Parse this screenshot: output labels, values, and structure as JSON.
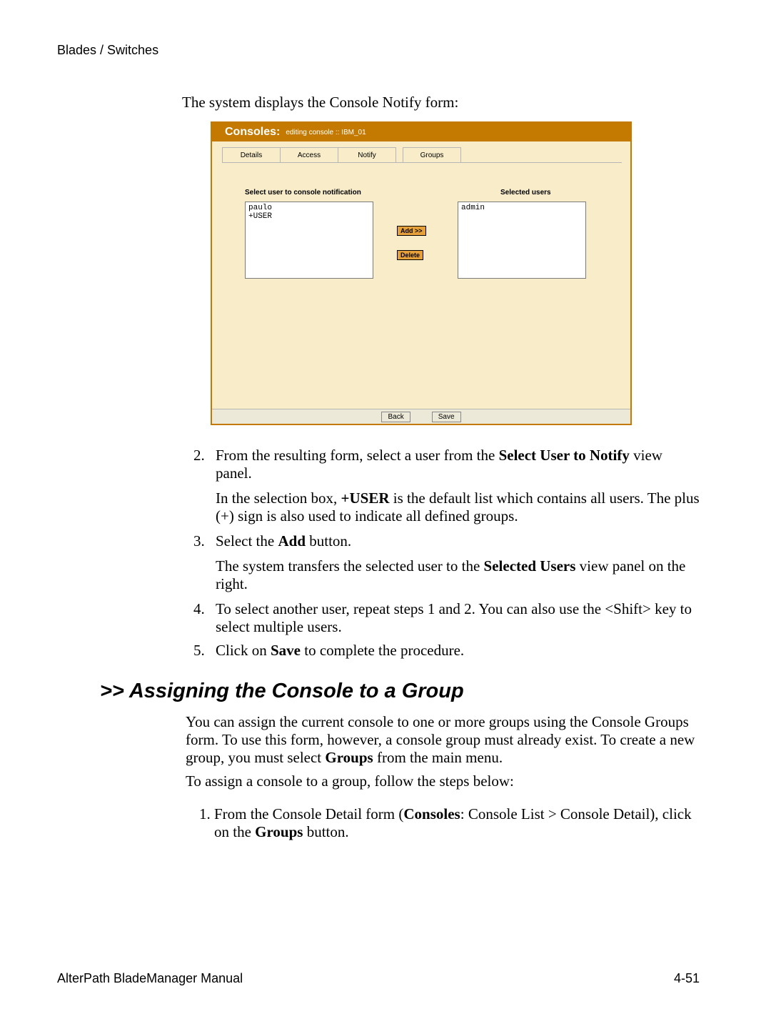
{
  "header": "Blades / Switches",
  "intro": "The system displays the Console Notify form:",
  "screenshot": {
    "title": "Consoles:",
    "subtitle": "editing console  ::  IBM_01",
    "tabs": [
      "Details",
      "Access",
      "Notify",
      "Groups"
    ],
    "left_label": "Select user to console notification",
    "right_label": "Selected users",
    "left_list": [
      "paulo",
      "+USER"
    ],
    "right_list": [
      "admin"
    ],
    "add_btn": "Add >>",
    "delete_btn": "Delete",
    "back_btn": "Back",
    "save_btn": "Save"
  },
  "steps1": {
    "s2a": "From the resulting form, select a user from the ",
    "s2b": "Select User to Notify",
    "s2c": " view panel.",
    "s2_detail_a": "In the selection box, ",
    "s2_detail_b": "+USER",
    "s2_detail_c": " is the default list which contains all users. The plus (+) sign is also used to indicate all defined groups.",
    "s3a": "Select the ",
    "s3b": "Add",
    "s3c": " button.",
    "s3_detail_a": "The system transfers the selected user to the ",
    "s3_detail_b": "Selected Users",
    "s3_detail_c": " view panel on the right.",
    "s4": "To select another user, repeat steps 1 and 2. You can also use the <Shift> key to select multiple users.",
    "s5a": "Click on ",
    "s5b": "Save",
    "s5c": " to complete the procedure."
  },
  "section_heading": ">> Assigning the Console to a Group",
  "body": {
    "p1a": "You can assign the current console to one or more groups using the Console Groups form. To use this form, however, a console group must already exist. To create a new group, you must select ",
    "p1b": "Groups",
    "p1c": " from the main menu.",
    "p2": "To assign a console to a group, follow the steps below:",
    "s1a": "From the Console Detail form (",
    "s1b": "Consoles",
    "s1c": ": Console List > Console Detail), click on the ",
    "s1d": "Groups",
    "s1e": " button."
  },
  "footer_left": "AlterPath BladeManager Manual",
  "footer_right": "4-51"
}
